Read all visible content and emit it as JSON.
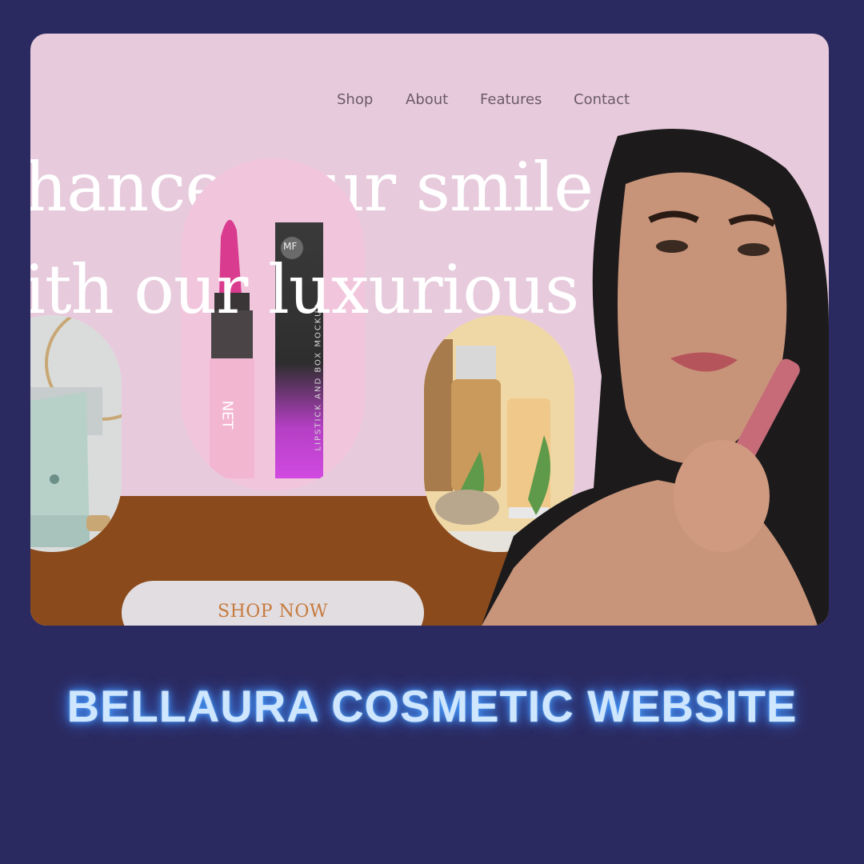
{
  "nav": {
    "items": [
      "Shop",
      "About",
      "Features",
      "Contact"
    ]
  },
  "hero": {
    "line1": "hance your smile",
    "line2": "ith our luxurious"
  },
  "products": {
    "lipstick_box_text": "LIPSTICK AND BOX MOCKUP",
    "lipstick_logo": "MF",
    "lipstick_tube_text": "NET"
  },
  "cta": {
    "label": "SHOP NOW"
  },
  "caption": "BELLAURA COSMETIC WEBSITE",
  "colors": {
    "page_bg": "#2b2a60",
    "card_pink": "#e7cbdc",
    "brown_band": "#8a4a1c",
    "cta_text": "#c77a3e",
    "caption_glow": "#4aa3ff"
  }
}
